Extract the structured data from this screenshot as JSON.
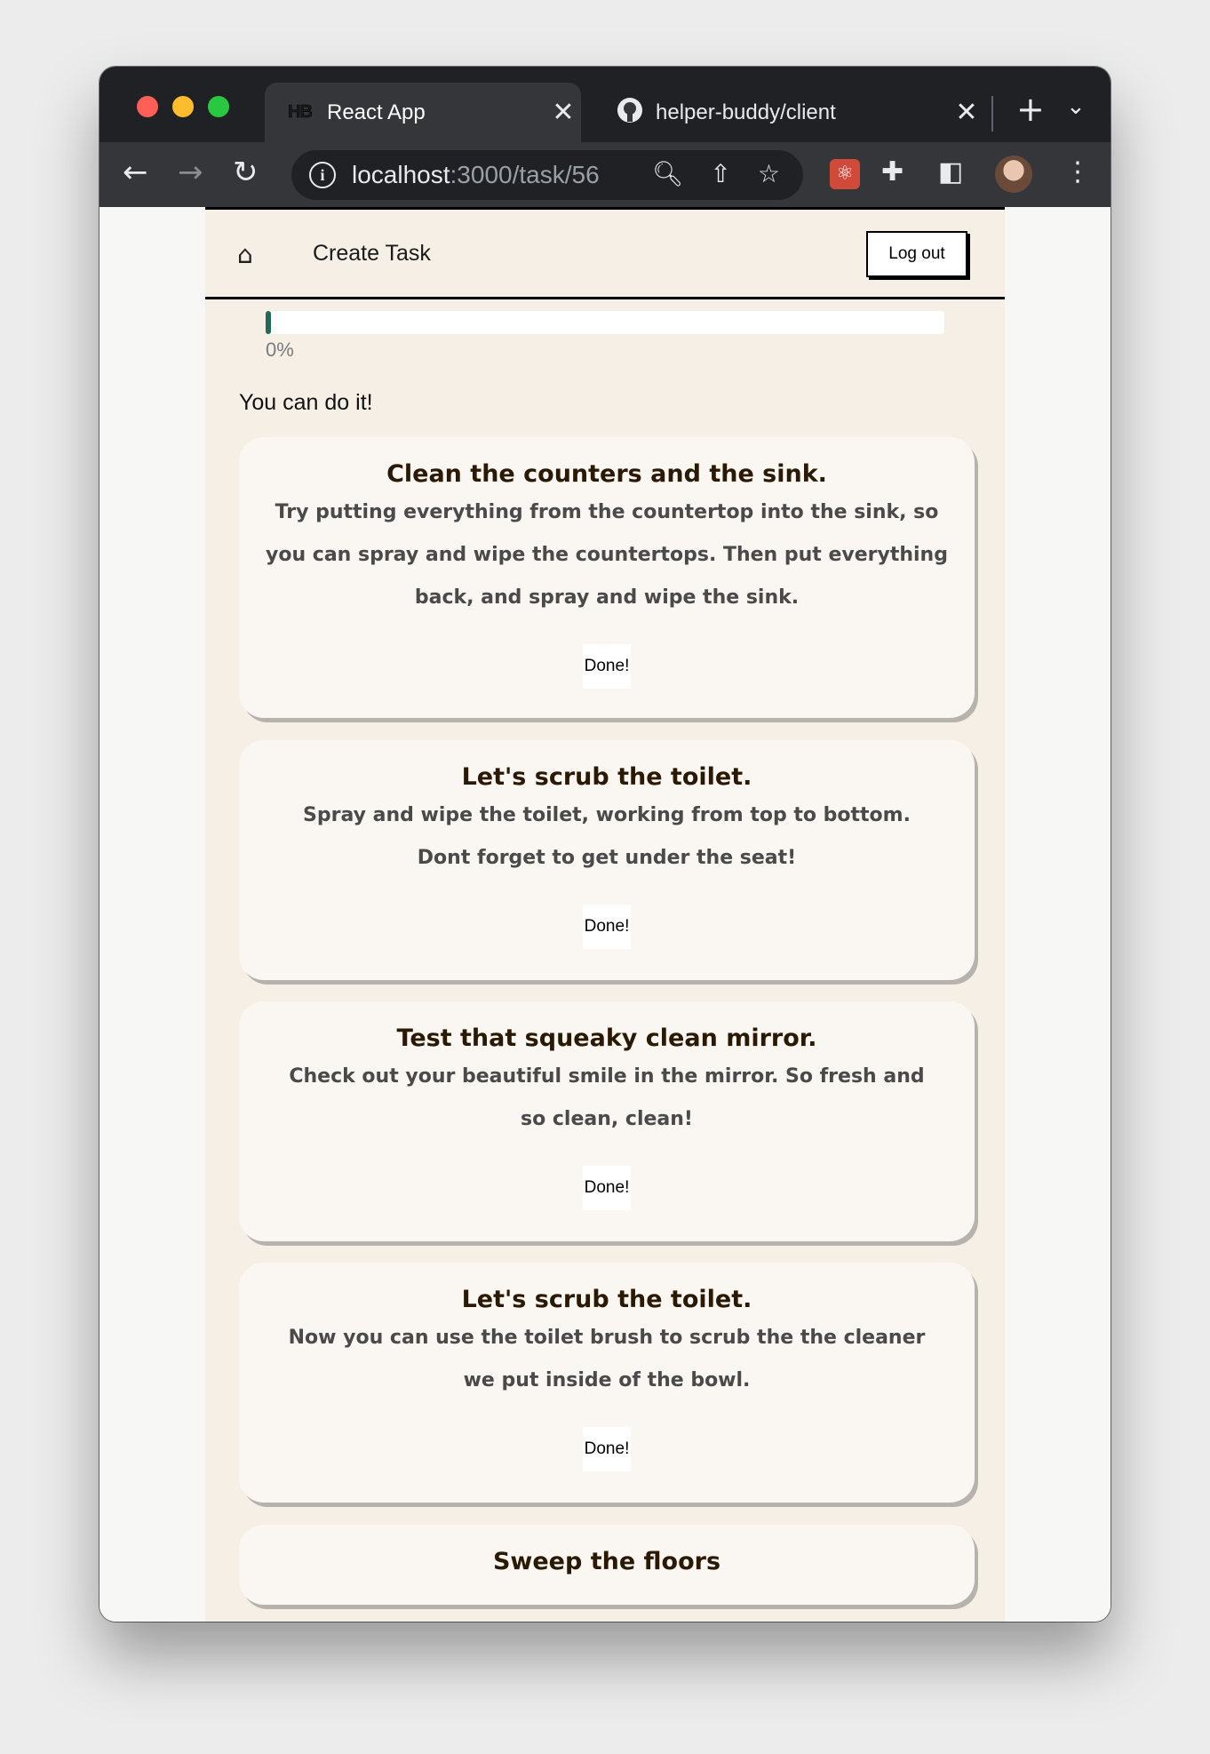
{
  "browser": {
    "tabs": [
      {
        "favicon": "HB",
        "title": "React App",
        "active": true
      },
      {
        "favicon": "github-icon",
        "title": "helper-buddy/client",
        "active": false
      }
    ],
    "url_host": "localhost",
    "url_path": ":3000/task/56"
  },
  "nav": {
    "create_task": "Create Task",
    "logout": "Log out"
  },
  "progress": {
    "value": 0,
    "label": "0%"
  },
  "encouragement": "You can do it!",
  "steps": [
    {
      "title": "Clean the counters and the sink.",
      "body": "Try putting everything from the countertop into the sink, so you can spray and wipe the countertops. Then put everything back, and spray and wipe the sink.",
      "button": "Done!"
    },
    {
      "title": "Let's scrub the toilet.",
      "body": "Spray and wipe the toilet, working from top to bottom. Dont forget to get under the seat!",
      "button": "Done!"
    },
    {
      "title": "Test that squeaky clean mirror.",
      "body": "Check out your beautiful smile in the mirror. So fresh and so clean, clean!",
      "button": "Done!"
    },
    {
      "title": "Let's scrub the toilet.",
      "body": "Now you can use the toilet brush to scrub the the cleaner we put inside of the bowl.",
      "button": "Done!"
    },
    {
      "title": "Sweep the floors"
    }
  ],
  "colors": {
    "progress_fill": "#1f6b56",
    "page_bg": "#f6efe6",
    "card_bg": "#faf7f2",
    "title_text": "#2a1a05"
  }
}
